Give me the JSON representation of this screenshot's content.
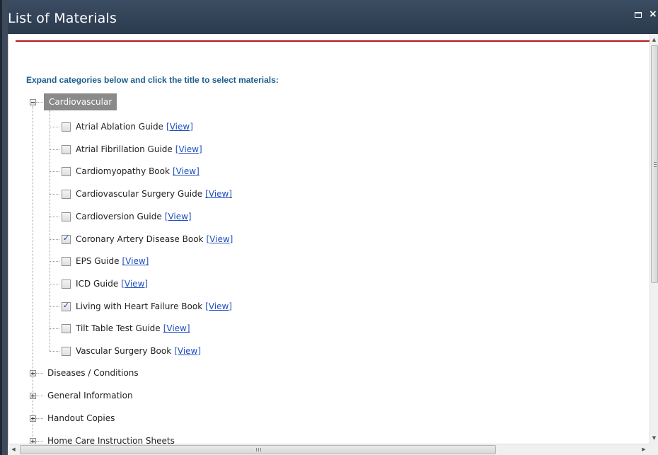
{
  "window": {
    "title": "List of Materials",
    "maximize_icon": "maximize-icon",
    "close_label": "×"
  },
  "instructions": "Expand categories below and click the title to select materials:",
  "categories": [
    {
      "label": "Cardiovascular",
      "expanded": true,
      "selected": true,
      "items": [
        {
          "label": "Atrial Ablation Guide",
          "link": "[View]",
          "checked": false
        },
        {
          "label": "Atrial Fibrillation Guide",
          "link": "[View]",
          "checked": false
        },
        {
          "label": "Cardiomyopathy Book",
          "link": "[View]",
          "checked": false
        },
        {
          "label": "Cardiovascular Surgery Guide",
          "link": "[View]",
          "checked": false
        },
        {
          "label": "Cardioversion Guide",
          "link": "[View]",
          "checked": false
        },
        {
          "label": "Coronary Artery Disease Book",
          "link": "[View]",
          "checked": true
        },
        {
          "label": "EPS Guide",
          "link": "[View]",
          "checked": false
        },
        {
          "label": "ICD Guide",
          "link": "[View]",
          "checked": false
        },
        {
          "label": "Living with Heart Failure Book",
          "link": "[View]",
          "checked": true
        },
        {
          "label": "Tilt Table Test Guide",
          "link": "[View]",
          "checked": false
        },
        {
          "label": "Vascular Surgery Book",
          "link": "[View]",
          "checked": false
        }
      ]
    },
    {
      "label": "Diseases / Conditions",
      "expanded": false,
      "items": []
    },
    {
      "label": "General Information",
      "expanded": false,
      "items": []
    },
    {
      "label": "Handout Copies",
      "expanded": false,
      "items": []
    },
    {
      "label": "Home Care Instruction Sheets",
      "expanded": false,
      "items": []
    }
  ],
  "checkmark": "✓",
  "colors": {
    "titlebar": "#34455a",
    "accent_line": "#b11c1c",
    "instructions": "#1c5d8c",
    "link": "#1f4fbf",
    "selected_category_bg": "#8a8a8a"
  },
  "scrollbars": {
    "vertical_up": "▲",
    "vertical_down": "▼",
    "horizontal_left": "◀",
    "horizontal_right": "▶"
  }
}
